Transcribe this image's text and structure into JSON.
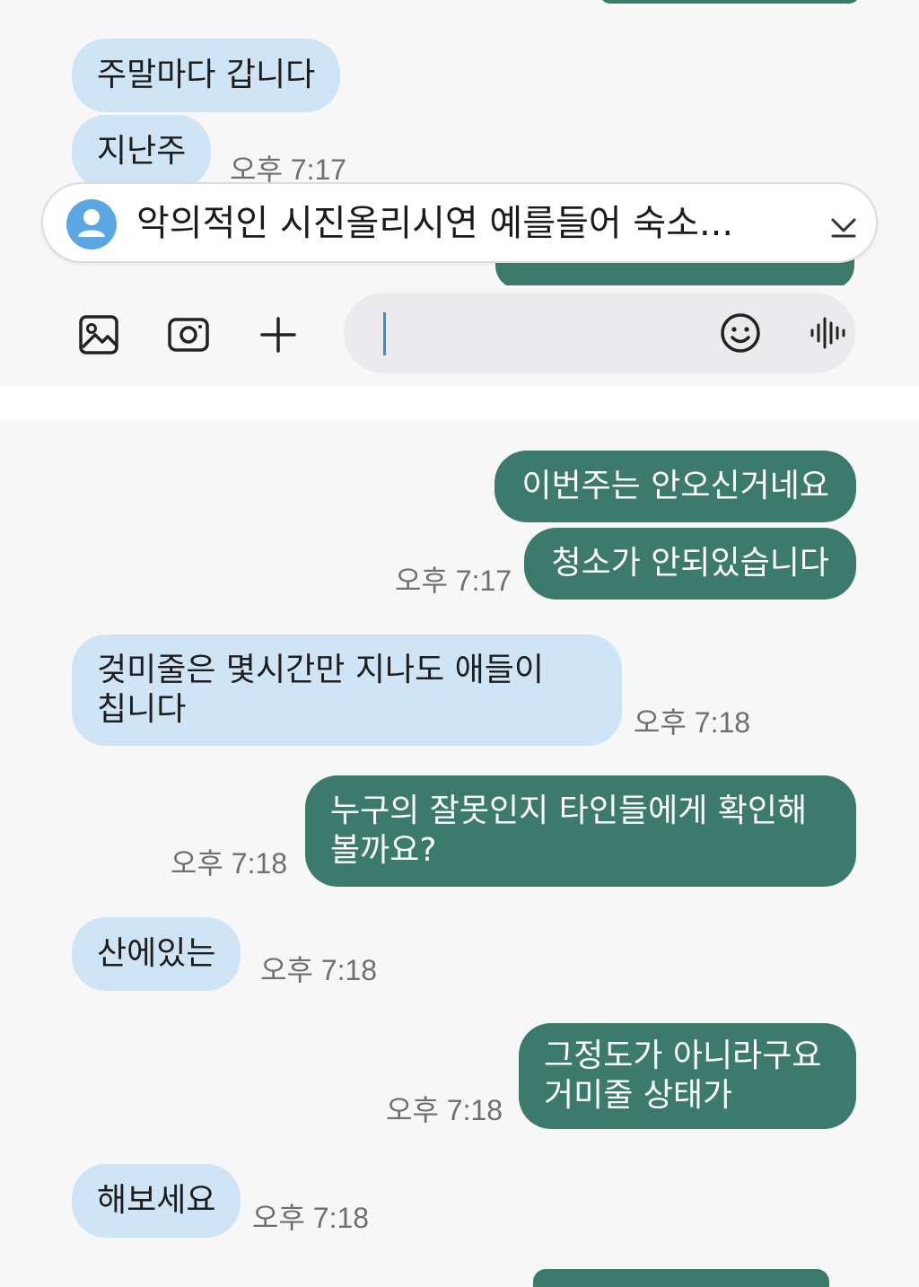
{
  "messages": [
    {
      "id": "m1",
      "dir": "in",
      "text": "주말마다 갑니다",
      "time": ""
    },
    {
      "id": "m2",
      "dir": "in",
      "text": "지난주",
      "time": "오후 7:17"
    },
    {
      "id": "m3",
      "dir": "out",
      "text": "이번주는 안오신거네요",
      "time": ""
    },
    {
      "id": "m4",
      "dir": "out",
      "text": "청소가 안되있습니다",
      "time": "오후 7:17"
    },
    {
      "id": "m5",
      "dir": "in",
      "lines": [
        "겆미줄은 몇시간만 지나도 애들이",
        "칩니다"
      ],
      "time": "오후 7:18"
    },
    {
      "id": "m6",
      "dir": "out",
      "lines": [
        "누구의 잘못인지 타인들에게 확인해",
        "볼까요?"
      ],
      "time": "오후 7:18"
    },
    {
      "id": "m7",
      "dir": "in",
      "text": "산에있는",
      "time": "오후 7:18"
    },
    {
      "id": "m8",
      "dir": "out",
      "lines": [
        "그정도가 아니라구요",
        "거미줄 상태가"
      ],
      "time": "오후 7:18"
    },
    {
      "id": "m9",
      "dir": "in",
      "text": "해보세요",
      "time": "오후 7:18"
    }
  ],
  "notice": {
    "text": "악의적인 시진올리시연 예를들어 숙소...",
    "icons": {
      "avatar": "person-avatar-icon",
      "expand": "chevron-down-icon"
    }
  },
  "composer": {
    "icons": [
      "gallery-icon",
      "camera-icon",
      "plus-icon",
      "emoji-icon",
      "voice-icon"
    ],
    "input_value": ""
  },
  "colors": {
    "incoming_bubble": "#cfe5f6",
    "outgoing_bubble": "#3c7b6b",
    "timestamp": "#6f6f6f",
    "background": "#f7f7f8"
  }
}
